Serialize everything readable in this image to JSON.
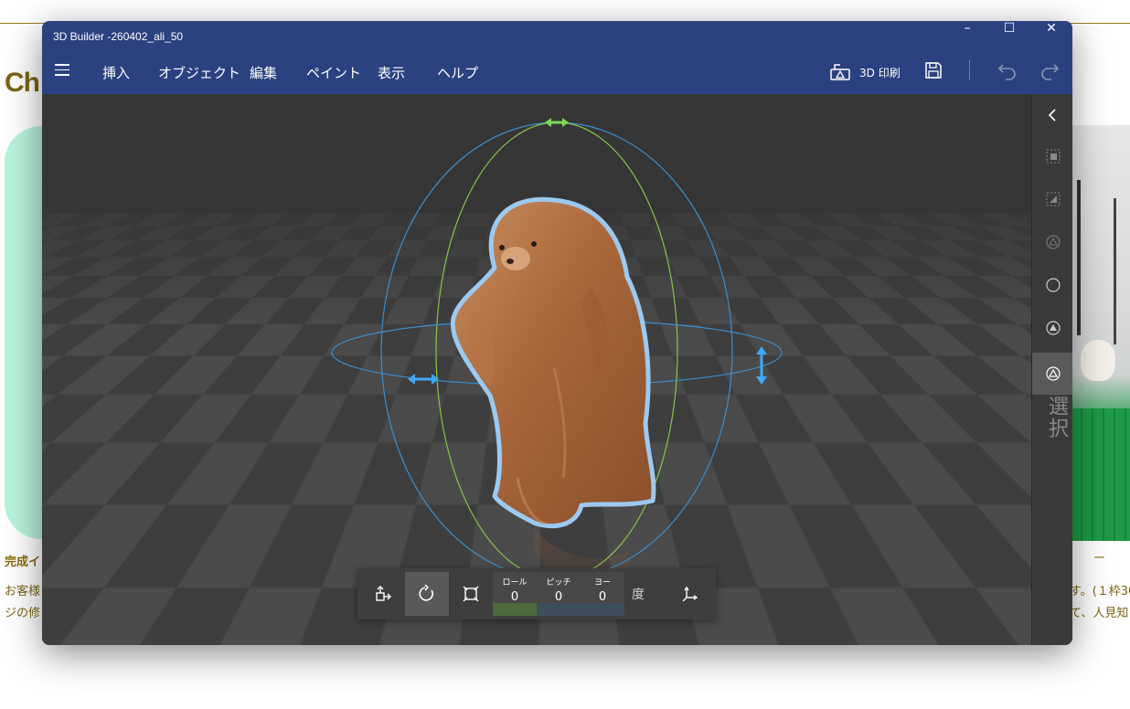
{
  "background_page": {
    "heading": "Ch",
    "caption": "完成イ",
    "body_line1": "お客様",
    "body_line2": "ジの修",
    "right_dash": "ー",
    "right_line1": "す。(１枠30",
    "right_line2": "て、人見知"
  },
  "window": {
    "title": "3D Builder -260402_ali_50",
    "controls": {
      "minimize": "–",
      "maximize": "☐",
      "close": "✕"
    }
  },
  "menu": {
    "items": [
      "挿入",
      "オブジェクト",
      "編集",
      "ペイント",
      "表示",
      "ヘルプ"
    ],
    "print_label": "3D 印刷"
  },
  "side_panel": {
    "mode_label": "選択"
  },
  "rotate_toolbar": {
    "roll_label": "ロール",
    "roll_value": "0",
    "pitch_label": "ピッチ",
    "pitch_value": "0",
    "yaw_label": "ヨー",
    "yaw_value": "0",
    "unit": "度"
  },
  "colors": {
    "accent": "#2b4180",
    "selection_outline": "#8fc3ef",
    "gizmo_blue": "#3fa9f5",
    "gizmo_green": "#7ed957"
  }
}
